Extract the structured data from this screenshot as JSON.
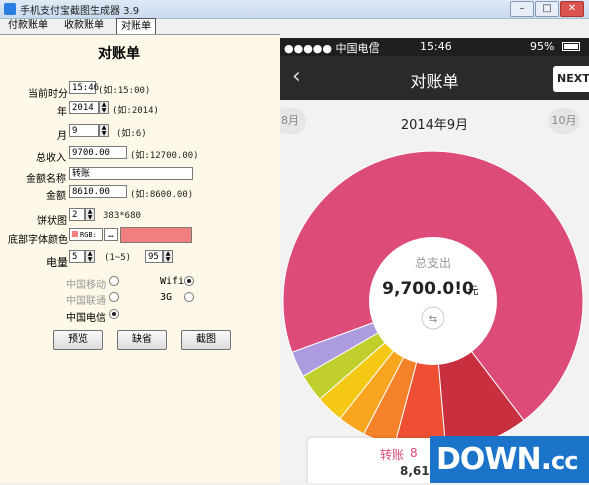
{
  "window": {
    "title": "手机支付宝截图生成器 3.9",
    "min": "–",
    "max": "□",
    "close": "✕"
  },
  "tabs": [
    "付款账单",
    "收款账单",
    "对账单"
  ],
  "form": {
    "heading": "对账单",
    "time": {
      "label": "当前时分",
      "value": "15:46",
      "hint": "(如:15:00)"
    },
    "year": {
      "label": "年",
      "value": "2014",
      "hint": "(如:2014)"
    },
    "month": {
      "label": "月",
      "value": "9",
      "hint": "(如:6)"
    },
    "income": {
      "label": "总收入",
      "value": "9700.00",
      "hint": "(如:12700.00)"
    },
    "name": {
      "label": "金额名称",
      "value": "转账"
    },
    "amount": {
      "label": "金额",
      "value": "8610.00",
      "hint": "(如:8600.00)"
    },
    "pie": {
      "label": "饼状图",
      "value": "2",
      "hint": "383*680"
    },
    "font_color": {
      "label": "底部字体颜色",
      "mode": "RGB:",
      "dots": "…",
      "color": "#f08080"
    },
    "battery": {
      "label": "电量",
      "value": "5",
      "range": "(1~5)",
      "value2": "95"
    },
    "carriers": [
      {
        "label": "中国移动",
        "checked": false,
        "disabled": true
      },
      {
        "label": "中国联通",
        "checked": false,
        "disabled": true
      },
      {
        "label": "中国电信",
        "checked": true,
        "disabled": false
      }
    ],
    "network": [
      {
        "label": "Wifi",
        "checked": true
      },
      {
        "label": "3G",
        "checked": false
      }
    ],
    "buttons": {
      "preview": "预览",
      "default": "缺省",
      "screenshot": "截图"
    }
  },
  "phone": {
    "status": {
      "carrier": "●●●●● 中国电信",
      "time": "15:46",
      "battery": "95%"
    },
    "nav": {
      "title": "对账单",
      "back": "‹",
      "next": "NEXT"
    },
    "month": {
      "prev": "8月",
      "current": "2014年9月",
      "next": "10月"
    },
    "center": {
      "label": "总支出",
      "amount": "9,700.0!0",
      "unit": "元"
    },
    "card": {
      "label": "转账",
      "label_suffix": "8",
      "amount": "8,610"
    },
    "pie_values": [
      0.702,
      0.09,
      0.055,
      0.035,
      0.03,
      0.03,
      0.03,
      0.028
    ],
    "pie_colors": [
      "#dd4b78",
      "#c8303f",
      "#ef4f33",
      "#f5822b",
      "#f9a51f",
      "#f5c813",
      "#c1cf2c",
      "#ad9be0"
    ]
  },
  "watermark": {
    "text": "DOWN.cc"
  }
}
